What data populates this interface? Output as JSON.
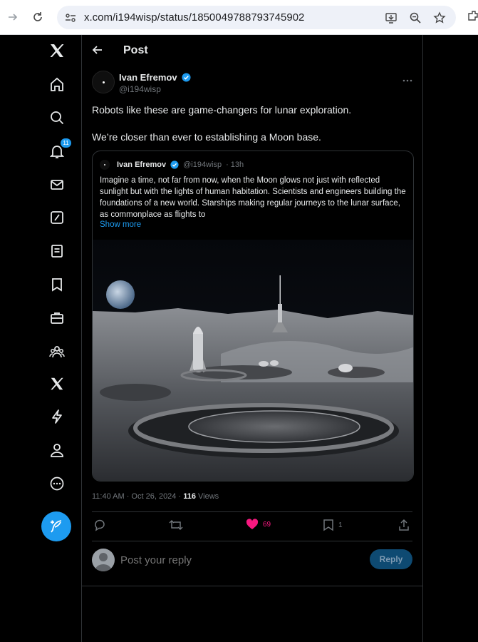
{
  "browser": {
    "url": "x.com/i194wisp/status/1850049788793745902"
  },
  "nav": {
    "notifications_badge": "11",
    "accent": "#1d9bf0"
  },
  "header": {
    "title": "Post"
  },
  "post": {
    "author_name": "Ivan Efremov",
    "author_handle": "@i194wisp",
    "text_line1": "Robots like these are game-changers for lunar exploration.",
    "text_line2": "We’re closer than ever to establishing a Moon base.",
    "timestamp": "11:40 AM · Oct 26, 2024 · ",
    "views_count": "116",
    "views_label": " Views",
    "likes": "69",
    "bookmarks": "1",
    "like_color": "#f91880"
  },
  "quote": {
    "author_name": "Ivan Efremov",
    "author_handle": "@i194wisp",
    "age": "· 13h",
    "text": "Imagine a time, not far from now, when the Moon glows not just with reflected sunlight but with the lights of human habitation. Scientists and engineers building the foundations of a new world. Starships making regular journeys to the lunar surface, as commonplace as flights to",
    "show_more": "Show more"
  },
  "reply": {
    "placeholder": "Post your reply",
    "button_label": "Reply"
  }
}
